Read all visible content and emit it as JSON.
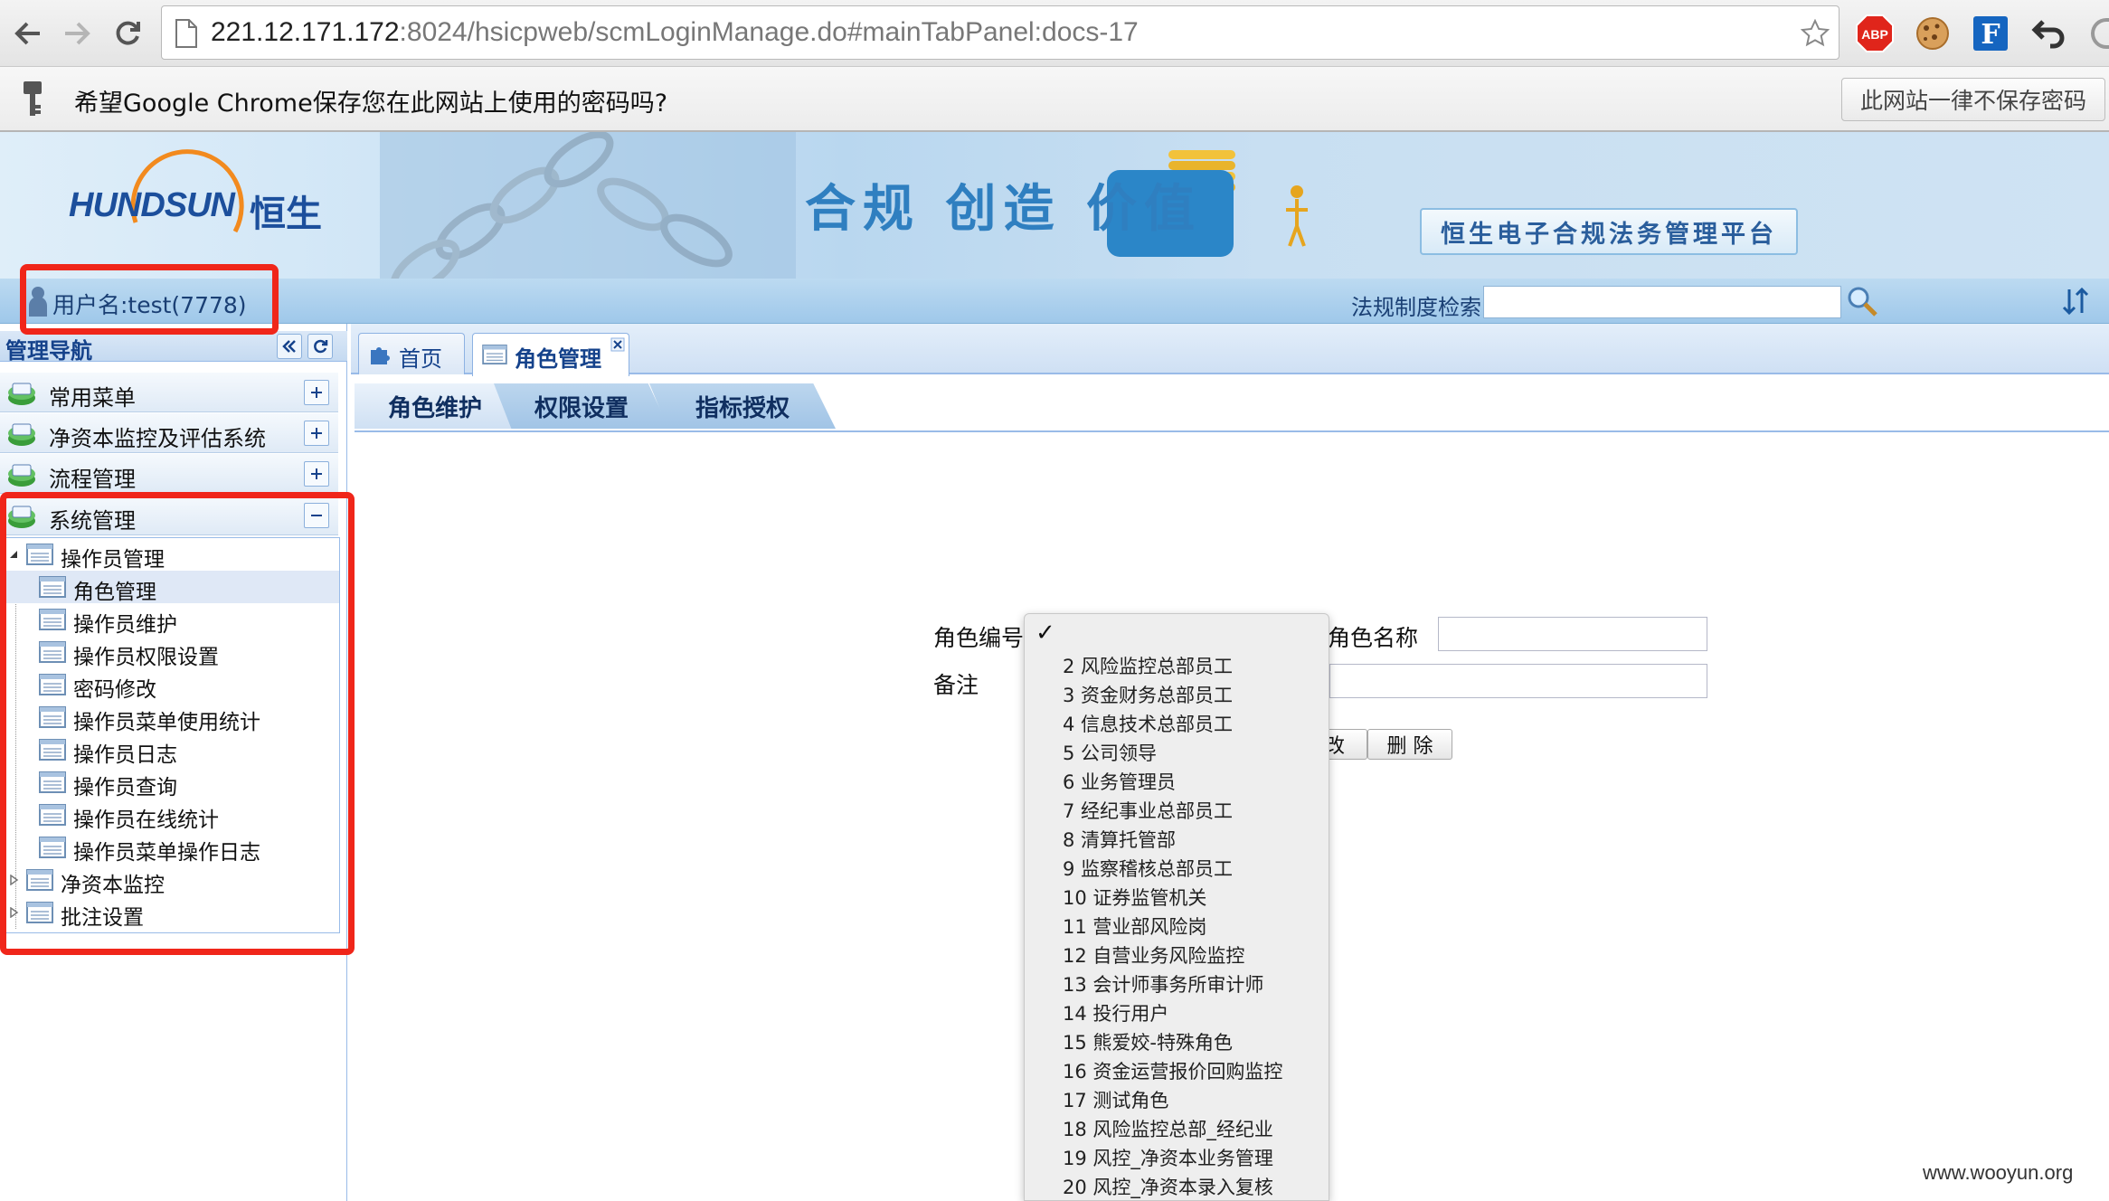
{
  "browser": {
    "url_host": "221.12.171.172",
    "url_rest": ":8024/hsicpweb/scmLoginManage.do#mainTabPanel:docs-17",
    "infobar_text": "希望Google Chrome保存您在此网站上使用的密码吗?",
    "never_save_label": "此网站一律不保存密码",
    "extensions": [
      "abp-icon",
      "cookie-icon",
      "f-icon",
      "undo-icon"
    ],
    "abp_label": "ABP",
    "f_label": "F"
  },
  "header": {
    "logo_text": "HUNDSUN",
    "logo_cn": "恒生",
    "slogan": "合规 创造 价值",
    "platform_title": "恒生电子合规法务管理平台",
    "username": "用户名:test(7778)",
    "search_label": "法规制度检索",
    "search_value": ""
  },
  "nav": {
    "title": "管理导航",
    "sections": [
      {
        "label": "常用菜单",
        "expanded": false
      },
      {
        "label": "净资本监控及评估系统",
        "expanded": false
      },
      {
        "label": "流程管理",
        "expanded": false
      },
      {
        "label": "系统管理",
        "expanded": true
      }
    ],
    "tree": [
      {
        "label": "操作员管理",
        "level": 0
      },
      {
        "label": "角色管理",
        "level": 1,
        "selected": true
      },
      {
        "label": "操作员维护",
        "level": 1
      },
      {
        "label": "操作员权限设置",
        "level": 1
      },
      {
        "label": "密码修改",
        "level": 1
      },
      {
        "label": "操作员菜单使用统计",
        "level": 1
      },
      {
        "label": "操作员日志",
        "level": 1
      },
      {
        "label": "操作员查询",
        "level": 1
      },
      {
        "label": "操作员在线统计",
        "level": 1
      },
      {
        "label": "操作员菜单操作日志",
        "level": 1
      },
      {
        "label": "净资本监控",
        "level": 0
      },
      {
        "label": "批注设置",
        "level": 0
      }
    ]
  },
  "tabs": [
    {
      "label": "首页",
      "active": false
    },
    {
      "label": "角色管理",
      "active": true
    }
  ],
  "subtabs": [
    {
      "label": "角色维护",
      "active": true
    },
    {
      "label": "权限设置",
      "active": false
    },
    {
      "label": "指标授权",
      "active": false
    }
  ],
  "form": {
    "role_id_label": "角色编号",
    "role_name_label": "角色名称",
    "note_label": "备注",
    "role_name_value": "",
    "note_value": "",
    "partial_button_label": "改",
    "delete_button_label": "删 除"
  },
  "dropdown": {
    "check_mark": "✓",
    "options": [
      "2 风险监控总部员工",
      "3 资金财务总部员工",
      "4 信息技术总部员工",
      "5 公司领导",
      "6 业务管理员",
      "7 经纪事业总部员工",
      "8 清算托管部",
      "9 监察稽核总部员工",
      "10 证券监管机关",
      "11 营业部风险岗",
      "12 自营业务风险监控",
      "13 会计师事务所审计师",
      "14 投行用户",
      "15 熊爱姣-特殊角色",
      "16 资金运营报价回购监控",
      "17 测试角色",
      "18 风险监控总部_经纪业",
      "19 风控_净资本业务管理",
      "20 风控_净资本录入复核"
    ]
  },
  "watermark": "www.wooyun.org",
  "colors": {
    "annotation_red": "#f0261a",
    "ext_blue": "#1565c0",
    "accent_blue": "#15428b"
  }
}
